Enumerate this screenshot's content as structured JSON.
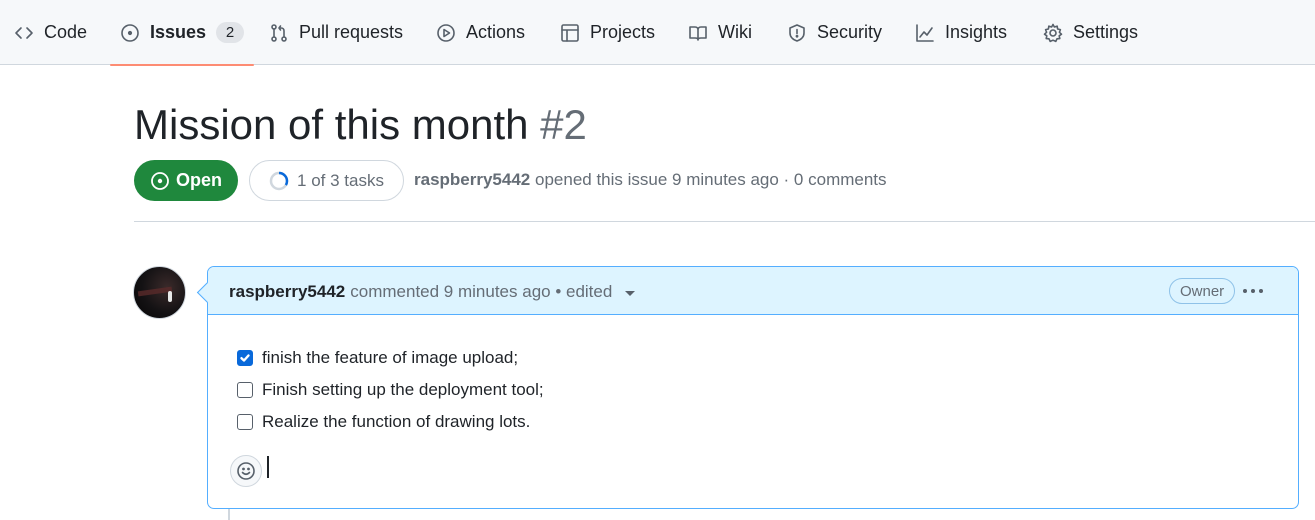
{
  "nav": {
    "tabs": [
      {
        "label": "Code",
        "icon": "code-icon"
      },
      {
        "label": "Issues",
        "icon": "issue-opened-icon",
        "counter": "2",
        "selected": true
      },
      {
        "label": "Pull requests",
        "icon": "git-pull-request-icon"
      },
      {
        "label": "Actions",
        "icon": "play-icon"
      },
      {
        "label": "Projects",
        "icon": "table-icon"
      },
      {
        "label": "Wiki",
        "icon": "book-icon"
      },
      {
        "label": "Security",
        "icon": "shield-icon"
      },
      {
        "label": "Insights",
        "icon": "graph-icon"
      },
      {
        "label": "Settings",
        "icon": "gear-icon"
      }
    ]
  },
  "issue": {
    "title": "Mission of this month",
    "number": "#2",
    "state": "Open",
    "tasks": "1 of 3 tasks",
    "tasks_progress": 0.3333,
    "author": "raspberry5442",
    "opened_text": "opened this issue 9 minutes ago · 0 comments"
  },
  "comment": {
    "author": "raspberry5442",
    "meta_text": "commented 9 minutes ago • edited",
    "badge": "Owner",
    "tasks": [
      {
        "label": "finish the feature of image upload;",
        "checked": true
      },
      {
        "label": "Finish setting up the deployment tool;",
        "checked": false
      },
      {
        "label": "Realize the function of drawing lots.",
        "checked": false
      }
    ]
  },
  "colors": {
    "accent_open": "#1f883d",
    "selected_underline": "#fd8c73",
    "comment_header_bg": "#ddf4ff",
    "comment_border": "#54aeff",
    "checkbox_checked": "#0969da"
  }
}
